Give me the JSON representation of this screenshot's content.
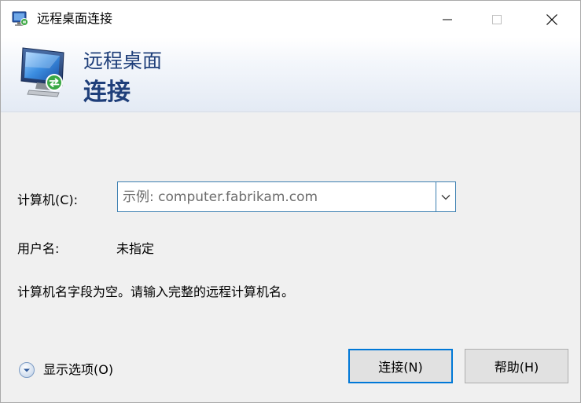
{
  "window": {
    "title": "远程桌面连接",
    "controls": {
      "minimize_icon": "minimize-icon",
      "maximize_icon": "maximize-icon",
      "close_icon": "close-icon"
    }
  },
  "banner": {
    "title": "远程桌面",
    "subtitle": "连接",
    "icon": "remote-desktop-monitor-icon"
  },
  "form": {
    "computer_label": "计算机(C):",
    "computer_placeholder": "示例: computer.fabrikam.com",
    "computer_value": "",
    "username_label": "用户名:",
    "username_value": "未指定",
    "message": "计算机名字段为空。请输入完整的远程计算机名。"
  },
  "footer": {
    "options_label": "显示选项(O)",
    "connect_label": "连接(N)",
    "help_label": "帮助(H)"
  },
  "colors": {
    "banner_text": "#1f3f7a",
    "accent": "#0078d7",
    "field_border": "#3c7fb1"
  }
}
